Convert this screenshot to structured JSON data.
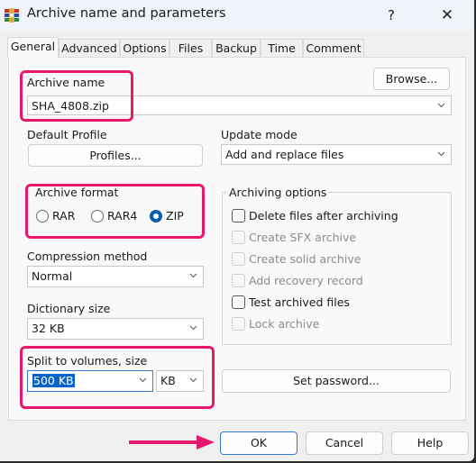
{
  "window": {
    "title": "Archive name and parameters",
    "help_label": "?",
    "close_label": "✕"
  },
  "tabs": [
    {
      "label": "General",
      "active": true
    },
    {
      "label": "Advanced"
    },
    {
      "label": "Options"
    },
    {
      "label": "Files"
    },
    {
      "label": "Backup"
    },
    {
      "label": "Time"
    },
    {
      "label": "Comment"
    }
  ],
  "general": {
    "archive_name_label": "Archive name",
    "archive_name_value": "SHA_4808.zip",
    "browse_label": "Browse...",
    "default_profile_label": "Default Profile",
    "profiles_label": "Profiles...",
    "update_mode_label": "Update mode",
    "update_mode_value": "Add and replace files",
    "archive_format": {
      "title": "Archive format",
      "options": [
        {
          "label": "RAR",
          "selected": false
        },
        {
          "label": "RAR4",
          "selected": false
        },
        {
          "label": "ZIP",
          "selected": true
        }
      ]
    },
    "compression_method_label": "Compression method",
    "compression_method_value": "Normal",
    "dictionary_size_label": "Dictionary size",
    "dictionary_size_value": "32 KB",
    "split_label": "Split to volumes, size",
    "split_value": "500 KB",
    "split_unit_value": "KB",
    "archiving_options": {
      "title": "Archiving options",
      "items": [
        {
          "label": "Delete files after archiving",
          "checked": false,
          "enabled": true
        },
        {
          "label": "Create SFX archive",
          "checked": false,
          "enabled": false
        },
        {
          "label": "Create solid archive",
          "checked": false,
          "enabled": false
        },
        {
          "label": "Add recovery record",
          "checked": false,
          "enabled": false
        },
        {
          "label": "Test archived files",
          "checked": false,
          "enabled": true
        },
        {
          "label": "Lock archive",
          "checked": false,
          "enabled": false
        }
      ]
    },
    "set_password_label": "Set password..."
  },
  "footer": {
    "ok_label": "OK",
    "cancel_label": "Cancel",
    "help_label": "Help"
  },
  "annotations": {
    "highlight_color": "#e8186d"
  }
}
